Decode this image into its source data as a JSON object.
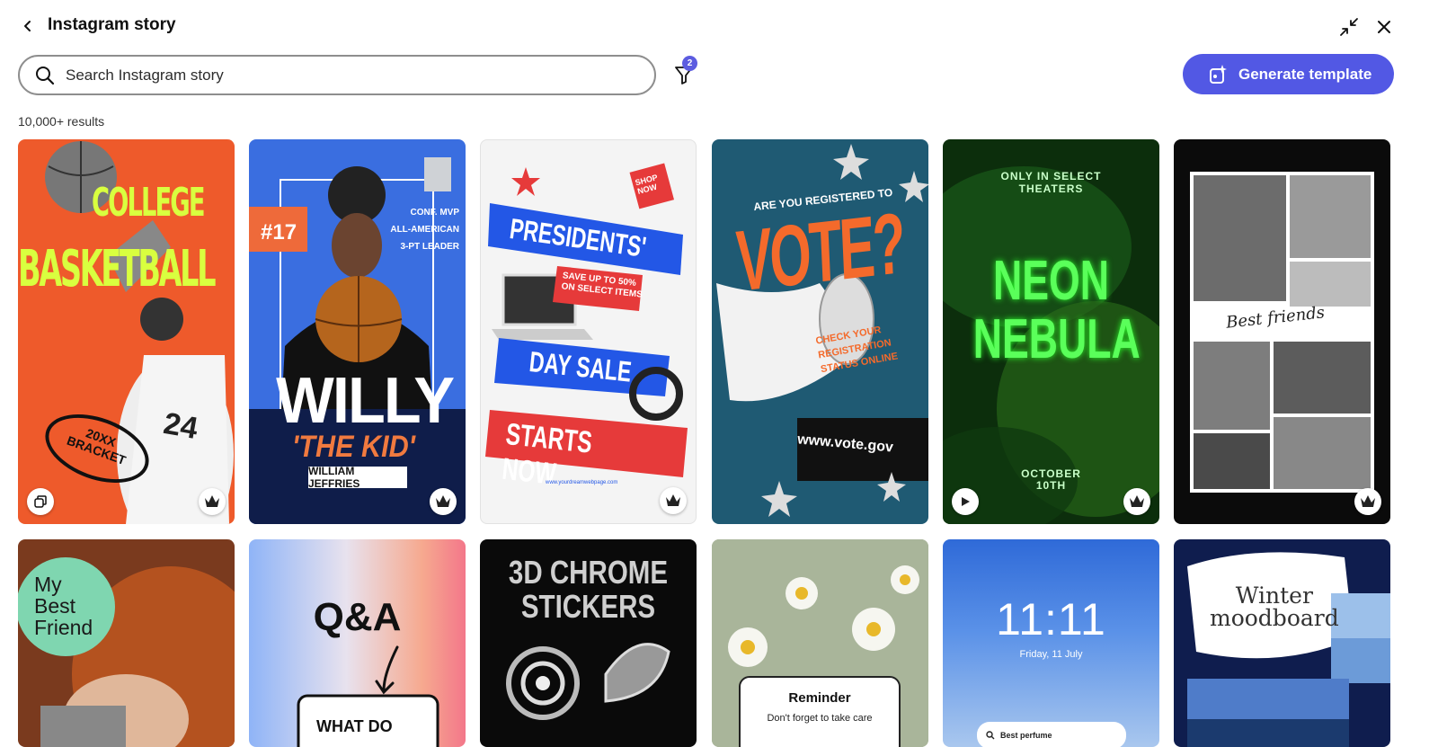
{
  "header": {
    "title": "Instagram story"
  },
  "search": {
    "placeholder": "Search Instagram story"
  },
  "filter": {
    "badge_count": "2"
  },
  "generate_button": {
    "label": "Generate template"
  },
  "results_label": "10,000+ results",
  "colors": {
    "accent": "#5258e4",
    "badge": "#5c5ce0"
  },
  "templates_row1": [
    {
      "lines": [
        "COLLEGE",
        "BASKETBALL"
      ],
      "badge_text": [
        "20XX",
        "BRACKET"
      ],
      "jersey": "24",
      "left_icon": "copy-icon",
      "right_icon": "premium-crown-icon"
    },
    {
      "number": "#17",
      "stats": [
        "CONF. MVP",
        "ALL-AMERICAN",
        "3-PT LEADER"
      ],
      "name_big": "WILLY",
      "name_quote": "'THE KID'",
      "fullname": "WILLIAM JEFFRIES",
      "right_icon": "premium-crown-icon"
    },
    {
      "shop": [
        "SHOP",
        "NOW"
      ],
      "line1": "PRESIDENTS'",
      "promo": [
        "SAVE UP TO 50%",
        "ON SELECT ITEMS"
      ],
      "line2": "DAY SALE",
      "line3": "STARTS NOW",
      "url": "www.yourdreamwebpage.com",
      "right_icon": "premium-crown-icon"
    },
    {
      "question": "ARE YOU REGISTERED TO",
      "big": "VOTE?",
      "check": [
        "CHECK YOUR",
        "REGISTRATION",
        "STATUS ONLINE"
      ],
      "url": "www.vote.gov"
    },
    {
      "top": [
        "ONLY IN SELECT",
        "THEATERS"
      ],
      "big": [
        "NEON",
        "NEBULA"
      ],
      "date": [
        "OCTOBER",
        "10TH"
      ],
      "left_icon": "play-icon",
      "right_icon": "premium-crown-icon"
    },
    {
      "script": "Best friends",
      "right_icon": "premium-crown-icon"
    }
  ],
  "templates_row2": [
    {
      "text": [
        "My",
        "Best",
        "Friend"
      ]
    },
    {
      "text": "Q&A",
      "sub": "WHAT DO"
    },
    {
      "text": [
        "3D CHROME",
        "STICKERS"
      ]
    },
    {
      "title": "Reminder",
      "body": "Don't forget to take care"
    },
    {
      "time": "11:11",
      "date": "Friday, 11 July",
      "search": "Best perfume"
    },
    {
      "text": [
        "Winter",
        "moodboard"
      ]
    }
  ]
}
